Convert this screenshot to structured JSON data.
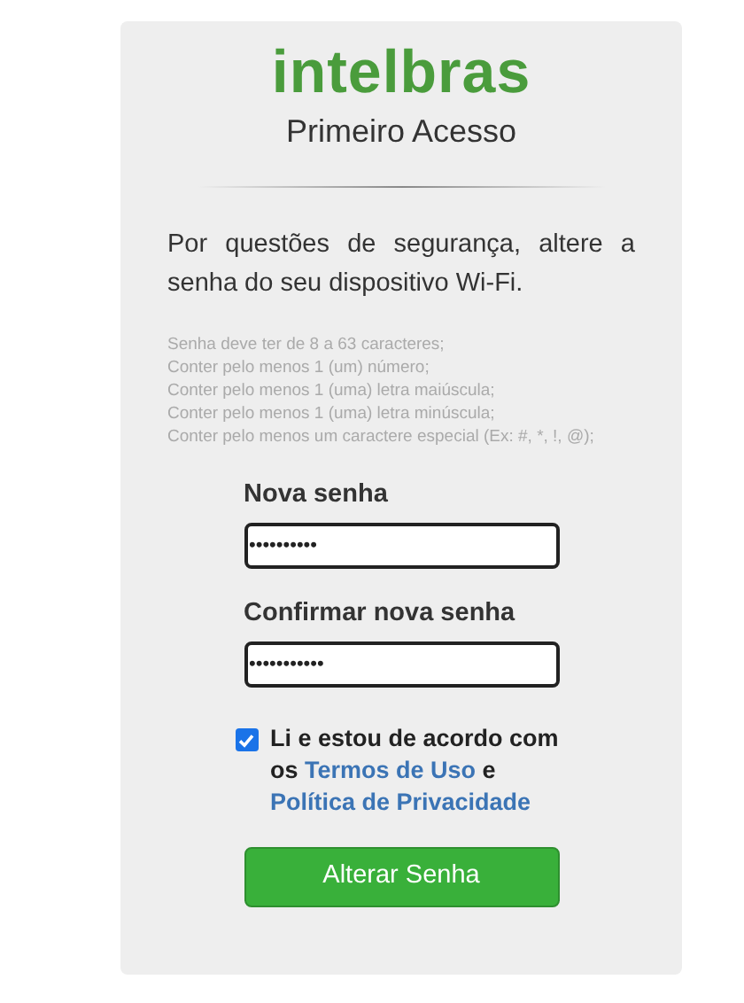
{
  "logo": "intelbras",
  "title": "Primeiro Acesso",
  "intro": "Por questões de segurança, altere a senha do seu dispositivo Wi-Fi.",
  "rules": [
    "Senha deve ter de 8 a 63 caracteres;",
    "Conter pelo menos 1 (um) número;",
    "Conter pelo menos 1 (uma) letra maiúscula;",
    "Conter pelo menos 1 (uma) letra minúscula;",
    "Conter pelo menos um caractere especial (Ex: #, *, !, @);"
  ],
  "fields": [
    {
      "label": "Nova senha",
      "value": "••••••••••"
    },
    {
      "label": "Confirmar nova senha",
      "value": "•••••••••••"
    }
  ],
  "agreement": {
    "checked": true,
    "text": "Li e estou de acordo com os",
    "link_1": "Termos de Uso",
    "joiner": "e",
    "link_2": "Política de Privacidade"
  },
  "button": "Alterar Senha"
}
